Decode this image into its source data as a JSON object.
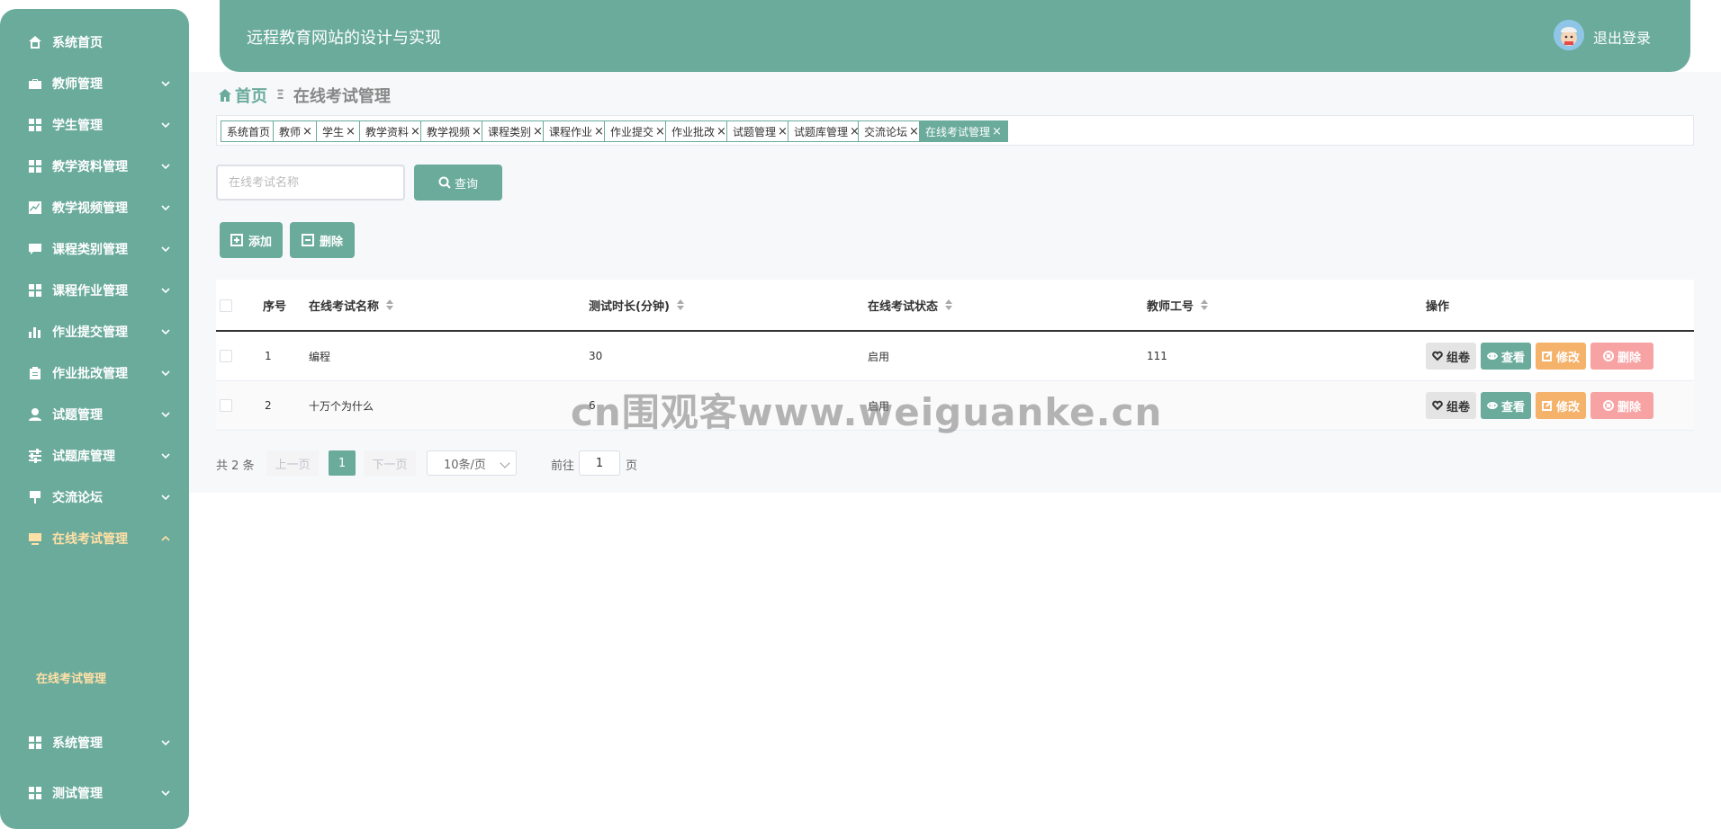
{
  "header": {
    "title": "远程教育网站的设计与实现",
    "logout_label": "退出登录"
  },
  "sidebar": {
    "items": [
      {
        "label": "系统首页",
        "icon": "home-icon",
        "expanded": false
      },
      {
        "label": "教师管理",
        "icon": "briefcase-icon",
        "expanded": false
      },
      {
        "label": "学生管理",
        "icon": "grid-icon",
        "expanded": false
      },
      {
        "label": "教学资料管理",
        "icon": "grid-icon",
        "expanded": false
      },
      {
        "label": "教学视频管理",
        "icon": "chart-icon",
        "expanded": false
      },
      {
        "label": "课程类别管理",
        "icon": "chat-icon",
        "expanded": false
      },
      {
        "label": "课程作业管理",
        "icon": "grid-icon",
        "expanded": false
      },
      {
        "label": "作业提交管理",
        "icon": "bar-chart-icon",
        "expanded": false
      },
      {
        "label": "作业批改管理",
        "icon": "clipboard-icon",
        "expanded": false
      },
      {
        "label": "试题管理",
        "icon": "user-icon",
        "expanded": false
      },
      {
        "label": "试题库管理",
        "icon": "sliders-icon",
        "expanded": false
      },
      {
        "label": "交流论坛",
        "icon": "sign-icon",
        "expanded": false
      },
      {
        "label": "在线考试管理",
        "icon": "monitor-icon",
        "expanded": true
      },
      {
        "label": "系统管理",
        "icon": "grid-icon",
        "expanded": false
      },
      {
        "label": "测试管理",
        "icon": "grid-icon",
        "expanded": false
      }
    ],
    "sub_item": "在线考试管理"
  },
  "breadcrumb": {
    "home": "首页",
    "current": "在线考试管理"
  },
  "tags": [
    {
      "label": "系统首页",
      "closable": false
    },
    {
      "label": "教师",
      "closable": true
    },
    {
      "label": "学生",
      "closable": true
    },
    {
      "label": "教学资料",
      "closable": true
    },
    {
      "label": "教学视频",
      "closable": true
    },
    {
      "label": "课程类别",
      "closable": true
    },
    {
      "label": "课程作业",
      "closable": true
    },
    {
      "label": "作业提交",
      "closable": true
    },
    {
      "label": "作业批改",
      "closable": true
    },
    {
      "label": "试题管理",
      "closable": true
    },
    {
      "label": "试题库管理",
      "closable": true
    },
    {
      "label": "交流论坛",
      "closable": true
    },
    {
      "label": "在线考试管理",
      "closable": true,
      "active": true
    }
  ],
  "search": {
    "placeholder": "在线考试名称",
    "value": "",
    "query_label": "查询"
  },
  "actions": {
    "add_label": "添加",
    "delete_label": "删除"
  },
  "table": {
    "columns": [
      "序号",
      "在线考试名称",
      "测试时长(分钟)",
      "在线考试状态",
      "教师工号",
      "操作"
    ],
    "rows": [
      {
        "index": "1",
        "name": "编程",
        "duration": "30",
        "status": "启用",
        "teacher_id": "111"
      },
      {
        "index": "2",
        "name": "十万个为什么",
        "duration": "6",
        "status": "启用",
        "teacher_id": ""
      }
    ],
    "row_actions": {
      "compose": "组卷",
      "view": "查看",
      "edit": "修改",
      "delete": "删除"
    }
  },
  "pagination": {
    "total": "共 2 条",
    "prev": "上一页",
    "current": "1",
    "next": "下一页",
    "page_size": "10条/页",
    "goto_label": "前往",
    "goto_value": "1",
    "page_suffix": "页"
  },
  "watermark": "cn围观客www.weiguanke.cn",
  "colors": {
    "primary": "#6aab9c",
    "warning": "#f5b26b",
    "danger": "#f7a3a3",
    "active_text": "#ffe0a6"
  }
}
